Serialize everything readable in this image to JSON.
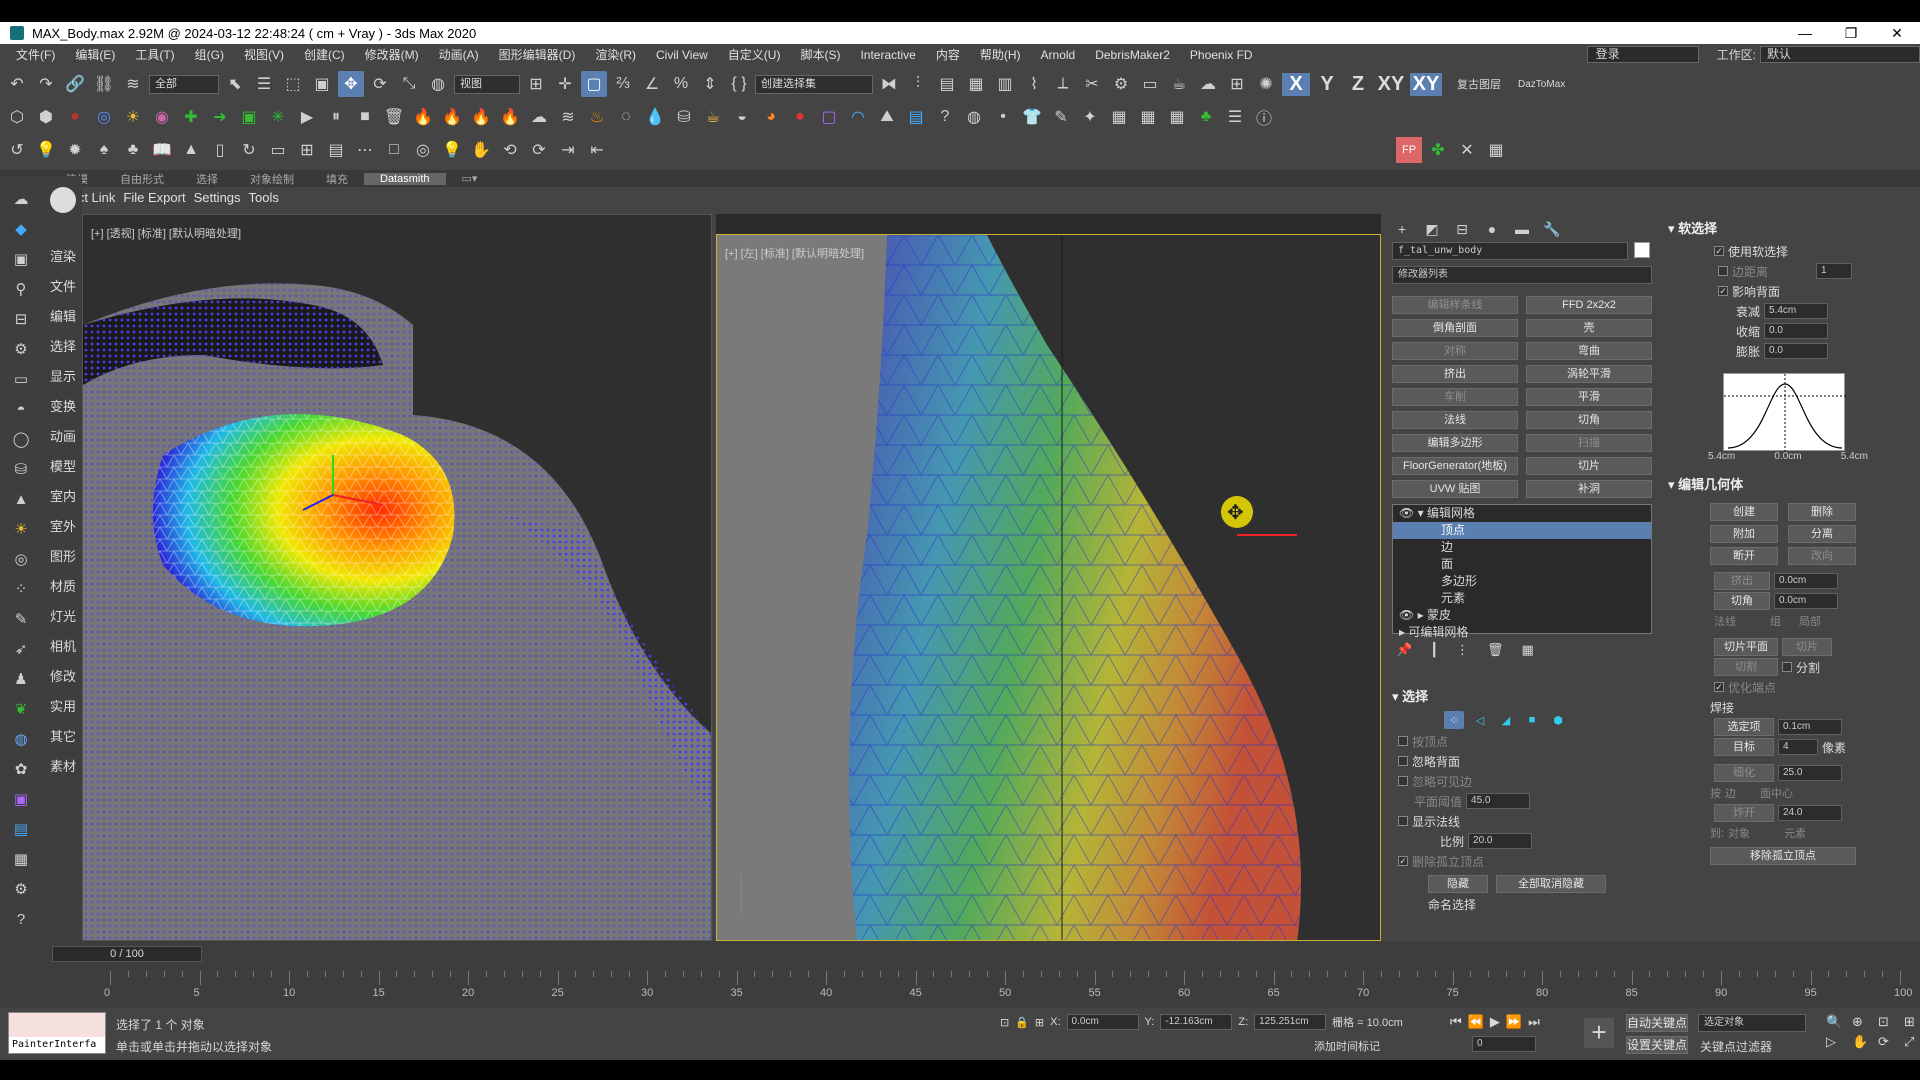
{
  "titlebar": {
    "title": "MAX_Body.max  2.92M @ 2024-03-12 22:48:24  ( cm + Vray ) - 3ds Max 2020",
    "min": "—",
    "restore": "❐",
    "close": "✕"
  },
  "menu": [
    "文件(F)",
    "编辑(E)",
    "工具(T)",
    "组(G)",
    "视图(V)",
    "创建(C)",
    "修改器(M)",
    "动画(A)",
    "图形编辑器(D)",
    "渲染(R)",
    "Civil View",
    "自定义(U)",
    "脚本(S)",
    "Interactive",
    "内容",
    "帮助(H)",
    "Arnold",
    "DebrisMaker2",
    "Phoenix FD"
  ],
  "login": "登录",
  "workspace_label": "工作区:",
  "workspace_value": "默认",
  "toolbar": {
    "filter": "全部",
    "view": "视图",
    "selset": "创建选择集",
    "axis_x": "X",
    "axis_y": "Y",
    "axis_z": "Z",
    "axis_xy": "XY",
    "axis_xy2": "XY",
    "restore_layer": "复古图层",
    "daztomax": "DazToMax"
  },
  "ribbon_tabs": [
    "建模",
    "自由形式",
    "选择",
    "对象绘制",
    "填充",
    "Datasmith"
  ],
  "ribbon_active": "Datasmith",
  "ribbon_tools": [
    "Direct Link",
    "File Export",
    "Settings",
    "Tools"
  ],
  "left_labels": [
    "",
    "渲染",
    "文件",
    "编辑",
    "选择",
    "显示",
    "变换",
    "动画",
    "模型",
    "室内",
    "室外",
    "图形",
    "材质",
    "灯光",
    "相机",
    "修改",
    "实用",
    "其它",
    "素材"
  ],
  "viewport1": {
    "label": "[+] [透视] [标准] [默认明暗处理]"
  },
  "viewport2": {
    "label": "[+] [左] [标准] [默认明暗处理]"
  },
  "object_name": "f_tal_unw_body",
  "modifier_list": "修改器列表",
  "modifier_buttons": [
    [
      "编辑样条线",
      "FFD 2x2x2"
    ],
    [
      "倒角剖面",
      "壳"
    ],
    [
      "对称",
      "弯曲"
    ],
    [
      "挤出",
      "涡轮平滑"
    ],
    [
      "车削",
      "平滑"
    ],
    [
      "法线",
      "切角"
    ],
    [
      "编辑多边形",
      "扫描"
    ],
    [
      "FloorGenerator(地板)",
      "切片"
    ],
    [
      "UVW 贴图",
      "补洞"
    ]
  ],
  "modifier_buttons_dim": [
    true,
    false,
    false,
    false,
    true,
    false,
    false,
    false,
    true,
    false,
    false,
    false,
    false,
    true,
    false,
    false,
    false,
    false
  ],
  "stack": {
    "items": [
      "编辑网格",
      "顶点",
      "边",
      "面",
      "多边形",
      "元素",
      "蒙皮",
      "可编辑网格"
    ]
  },
  "selection": {
    "title": "选择",
    "by_vertex": "按顶点",
    "ignore_back": "忽略背面",
    "ignore_visible": "忽略可见边",
    "plane_thresh": "平面阈值",
    "plane_val": "45.0",
    "show_normals": "显示法线",
    "scale": "比例",
    "scale_val": "20.0",
    "delete_isolated": "删除孤立顶点",
    "hide": "隐藏",
    "unhide_all": "全部取消隐藏",
    "named_sel": "命名选择"
  },
  "soft": {
    "title": "软选择",
    "use": "使用软选择",
    "edge_dist": "边距离",
    "edge_val": "1",
    "affect_back": "影响背面",
    "falloff": "衰减",
    "falloff_val": "5.4cm",
    "pinch": "收缩",
    "pinch_val": "0.0",
    "bubble": "膨胀",
    "bubble_val": "0.0",
    "curve_left": "5.4cm",
    "curve_mid": "0.0cm",
    "curve_right": "5.4cm"
  },
  "geom": {
    "title": "编辑几何体",
    "create": "创建",
    "delete": "删除",
    "attach": "附加",
    "detach": "分离",
    "break": "断开",
    "turn": "改向",
    "extrude": "挤出",
    "extrude_val": "0.0cm",
    "chamfer": "切角",
    "chamfer_val": "0.0cm",
    "normal": "法线",
    "group": "组",
    "local": "局部",
    "slice_plane": "切片平面",
    "slice": "切片",
    "cut": "切割",
    "split": "分割",
    "refine_ends": "优化端点",
    "weld": "焊接",
    "selected": "选定项",
    "selected_val": "0.1cm",
    "target": "目标",
    "target_val": "4",
    "pixels": "像素",
    "tessellate": "细化",
    "tess_val": "25.0",
    "by": "按",
    "edge": "边",
    "face_center": "面中心",
    "explode": "炸开",
    "explode_val": "24.0",
    "to": "到:",
    "object": "对象",
    "element": "元素",
    "remove_isolated": "移除孤立顶点"
  },
  "timeline": {
    "slider": "0 / 100",
    "ticks": [
      0,
      5,
      10,
      15,
      20,
      25,
      30,
      35,
      40,
      45,
      50,
      55,
      60,
      65,
      70,
      75,
      80,
      85,
      90,
      95,
      100
    ]
  },
  "status": {
    "selected": "选择了 1 个 对象",
    "hint": "单击或单击并拖动以选择对象",
    "script_box": "PainterInterfa",
    "x_label": "X:",
    "x_val": "0.0cm",
    "y_label": "Y:",
    "y_val": "-12.163cm",
    "z_label": "Z:",
    "z_val": "125.251cm",
    "grid": "栅格 = 10.0cm",
    "add_time_tag": "添加时间标记",
    "auto_key": "自动关键点",
    "selected_obj": "选定对象",
    "set_key": "设置关键点",
    "key_filter": "关键点过滤器",
    "frame": "0"
  },
  "colors": {
    "accent": "#5a7fb0",
    "viewport_active_border": "#c8b234",
    "mesh_blue": "#4a3cf0"
  }
}
